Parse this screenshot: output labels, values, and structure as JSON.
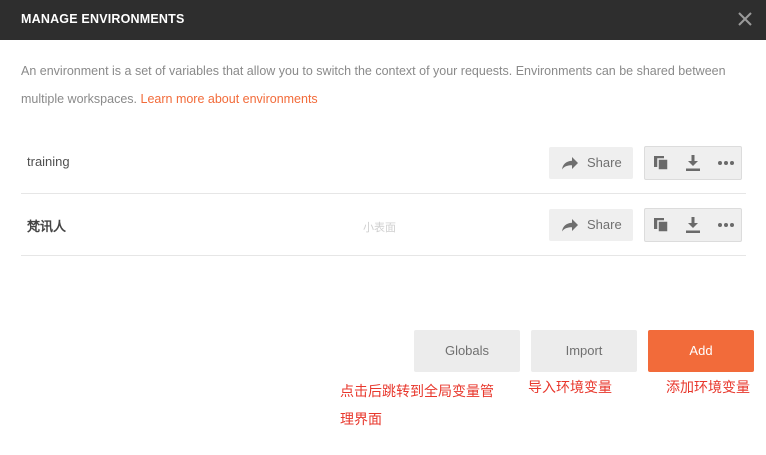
{
  "header": {
    "title": "MANAGE ENVIRONMENTS",
    "close_icon": "close-icon"
  },
  "description": {
    "text": "An environment is a set of variables that allow you to switch the context of your requests. Environments can be shared between multiple workspaces. ",
    "link": "Learn more about environments"
  },
  "environments": [
    {
      "name": "training",
      "share_label": "Share"
    },
    {
      "name": "梵讯人",
      "share_label": "Share"
    }
  ],
  "watermark": "小表面",
  "footer": {
    "globals_label": "Globals",
    "import_label": "Import",
    "add_label": "Add"
  },
  "annotations": {
    "globals_note": "点击后跳转到全局变量管理界面",
    "import_note": "导入环境变量",
    "add_note": "添加环境变量"
  },
  "colors": {
    "accent": "#f26b3a",
    "header_bg": "#2e2e2e",
    "annotation": "#e8372c"
  }
}
